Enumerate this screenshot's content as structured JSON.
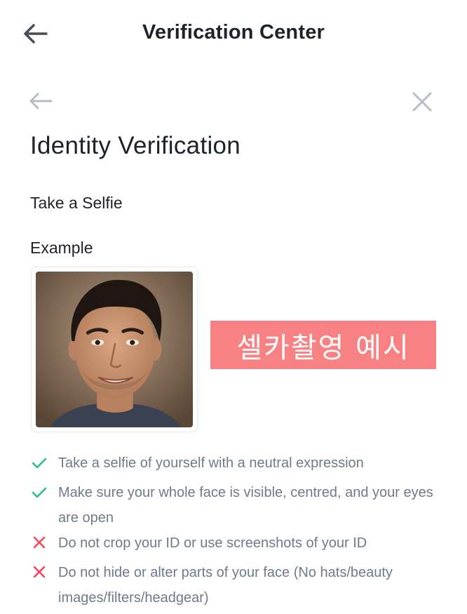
{
  "header": {
    "title": "Verification Center",
    "back_icon": "arrow-left-icon"
  },
  "modal": {
    "back_icon": "arrow-left-icon",
    "close_icon": "close-icon",
    "heading": "Identity Verification",
    "subheading": "Take a Selfie",
    "example_label": "Example",
    "photo": "selfie-example-photo",
    "overlay_caption": "셀카촬영 예시"
  },
  "rules": [
    {
      "type": "do",
      "icon": "check-icon",
      "color": "#2ebd85",
      "text": "Take a selfie of yourself with a neutral expression"
    },
    {
      "type": "do",
      "icon": "check-icon",
      "color": "#2ebd85",
      "text": "Make sure your whole face is visible, centred, and your eyes are open"
    },
    {
      "type": "dont",
      "icon": "cross-icon",
      "color": "#f6465d",
      "text": "Do not crop your ID or use screenshots of your ID"
    },
    {
      "type": "dont",
      "icon": "cross-icon",
      "color": "#f6465d",
      "text": "Do not hide or alter parts of your face (No hats/beauty images/filters/headgear)"
    }
  ],
  "colors": {
    "text_primary": "#1e2329",
    "text_secondary": "#707a8a",
    "icon_muted": "#b7bdc6",
    "caption_bg": "#f88184",
    "success": "#2ebd85",
    "error": "#f6465d"
  }
}
